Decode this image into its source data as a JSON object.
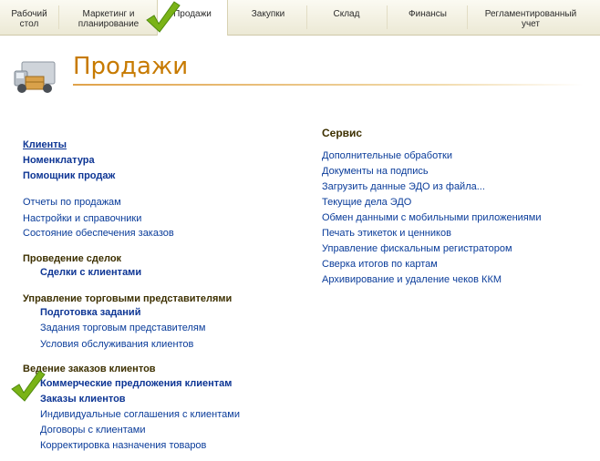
{
  "tabs": [
    {
      "label": "Рабочий\nстол"
    },
    {
      "label": "Маркетинг и\nпланирование"
    },
    {
      "label": "Продажи"
    },
    {
      "label": "Закупки"
    },
    {
      "label": "Склад"
    },
    {
      "label": "Финансы"
    },
    {
      "label": "Регламентированный\nучет"
    }
  ],
  "page": {
    "title": "Продажи"
  },
  "left": {
    "main_links": [
      "Клиенты",
      "Номенклатура",
      "Помощник продаж"
    ],
    "reports_links": [
      "Отчеты по продажам",
      "Настройки и справочники",
      "Состояние обеспечения заказов"
    ],
    "deals": {
      "title": "Проведение сделок",
      "items": [
        "Сделки с клиентами"
      ]
    },
    "reps": {
      "title": "Управление торговыми представителями",
      "items": [
        "Подготовка заданий",
        "Задания торговым представителям",
        "Условия обслуживания клиентов"
      ]
    },
    "orders": {
      "title": "Ведение заказов клиентов",
      "items": [
        "Коммерческие предложения клиентам",
        "Заказы клиентов",
        "Индивидуальные соглашения с клиентами",
        "Договоры с клиентами",
        "Корректировка назначения товаров"
      ]
    }
  },
  "service": {
    "title": "Сервис",
    "items": [
      "Дополнительные обработки",
      "Документы на подпись",
      "Загрузить данные ЭДО из файла...",
      "Текущие дела ЭДО",
      "Обмен данными с мобильными приложениями",
      "Печать этикеток и ценников",
      "Управление фискальным регистратором",
      "Сверка итогов по картам",
      "Архивирование и удаление чеков ККМ"
    ]
  },
  "colors": {
    "title": "#c77a00",
    "link": "#0a3c9a",
    "heading": "#3d3000",
    "check": "#7ab317"
  },
  "icons": {
    "header": "delivery-truck-icon",
    "mark": "checkmark-icon"
  }
}
